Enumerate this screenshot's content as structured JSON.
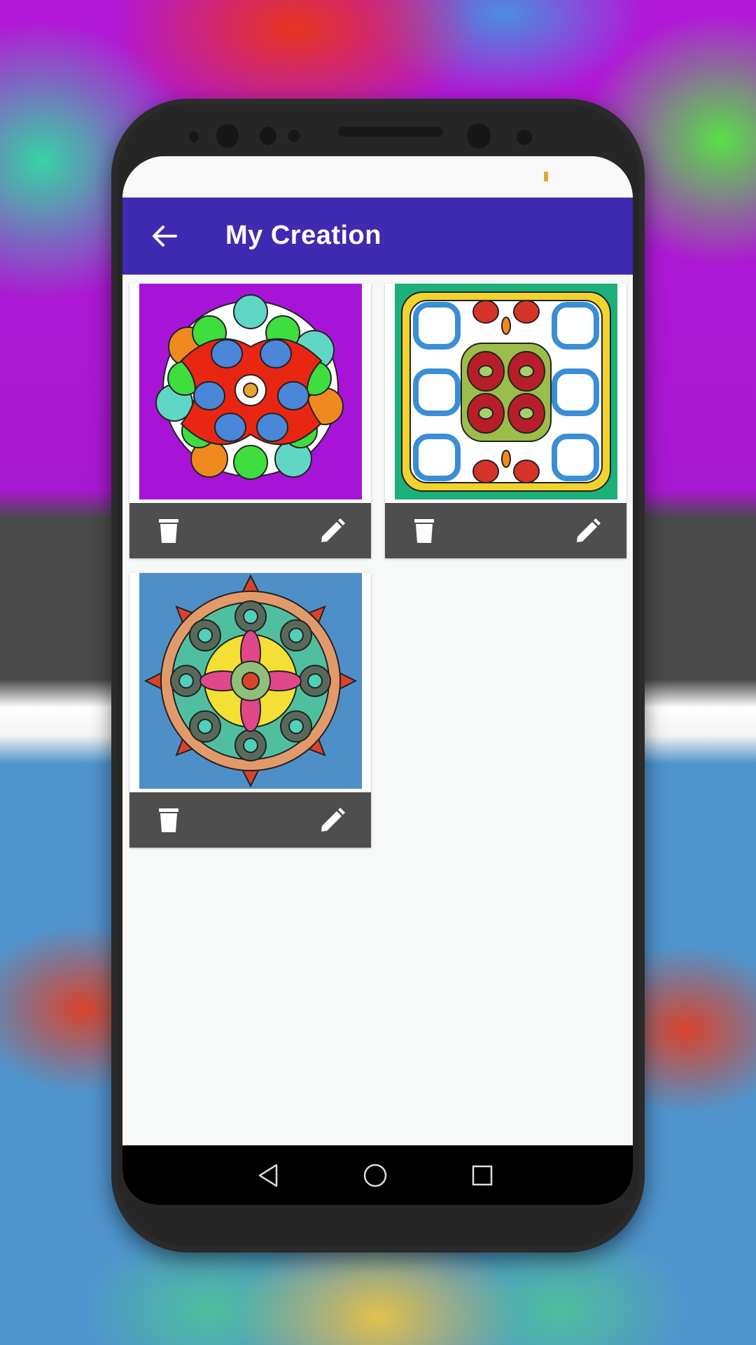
{
  "app": {
    "title": "My Creation",
    "colors": {
      "appbar": "#3f2ab2",
      "card_toolbar": "#4e4e4e",
      "screen_bg": "#f7f8f8",
      "battery": "#e8a432"
    }
  },
  "header": {
    "back_icon": "arrow-left-icon",
    "title": "My Creation"
  },
  "creations": [
    {
      "name": "mandala-swirl-purple",
      "background": "#a714d8",
      "actions": [
        "delete-icon",
        "edit-icon"
      ]
    },
    {
      "name": "pattern-squares-green",
      "background": "#1cb07a",
      "actions": [
        "delete-icon",
        "edit-icon"
      ]
    },
    {
      "name": "mandala-flower-blue",
      "background": "#4f8fc8",
      "actions": [
        "delete-icon",
        "edit-icon"
      ]
    }
  ],
  "navbar": {
    "items": [
      "back-triangle-icon",
      "home-circle-icon",
      "recents-square-icon"
    ]
  }
}
